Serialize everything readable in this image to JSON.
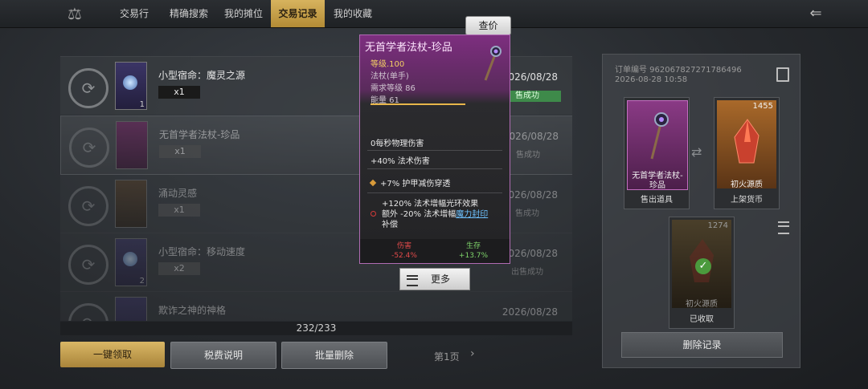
{
  "nav": {
    "tabs": [
      "交易行",
      "精确搜索",
      "我的摊位",
      "交易记录",
      "我的收藏"
    ],
    "active_tab": "交易记录",
    "price_button": "查价"
  },
  "records": [
    {
      "name": "小型宿命：魔灵之源",
      "qty": "x1",
      "count": "1",
      "date": "2026/08/28",
      "status": "售成功"
    },
    {
      "name": "无首学者法杖-珍品",
      "qty": "x1",
      "count": "",
      "date": "2026/08/28",
      "status": "售成功"
    },
    {
      "name": "涌动灵感",
      "qty": "x1",
      "count": "",
      "date": "2026/08/28",
      "status": "售成功"
    },
    {
      "name": "小型宿命：移动速度",
      "qty": "x2",
      "count": "2",
      "date": "2026/08/28",
      "status": "出售成功"
    },
    {
      "name": "欺诈之神的神格",
      "qty": "",
      "count": "",
      "date": "2026/08/28",
      "status": ""
    }
  ],
  "pagination": {
    "progress": "232/233",
    "page": "第1页"
  },
  "buttons": {
    "claim_all": "一键领取",
    "tax_info": "税费说明",
    "batch_delete": "批量删除",
    "delete_record": "删除记录"
  },
  "tooltip": {
    "title": "无首学者法杖-珍品",
    "level": "等级.100",
    "type": "法杖(单手)",
    "req_level": "需求等级 86",
    "energy": "能量 61",
    "stats": [
      "0每秒物理伤害",
      "+40% 法术伤害",
      "+7% 护甲减伤穿透"
    ],
    "special_line1": "+120% 法术增幅光环效果",
    "special_line2_prefix": "额外 -20% 法术增幅",
    "special_link": "魔力封印",
    "special_line3": "补偿",
    "damage_label": "伤害",
    "damage_value": "-52.4%",
    "survive_label": "生存",
    "survive_value": "+13.7%",
    "more_button": "更多"
  },
  "order": {
    "number_line1": "订单编号 962067827271786496",
    "number_line2": "2026-08-28 10:58",
    "sold_item_caption": "售出道具",
    "sold_item_name_line1": "无首学者法杖-",
    "sold_item_name_line2": "珍品",
    "currency_caption": "上架货币",
    "currency_name": "初火源质",
    "currency_amount": "1455",
    "received_caption": "已收取",
    "received_name": "初火源质",
    "received_amount": "1274"
  },
  "colors": {
    "gold": "#c9a24e",
    "success_green": "#3e8a4a",
    "rare_pink": "#8a3a85",
    "damage_red": "#e24a4a",
    "survive_green": "#7ed36a"
  }
}
